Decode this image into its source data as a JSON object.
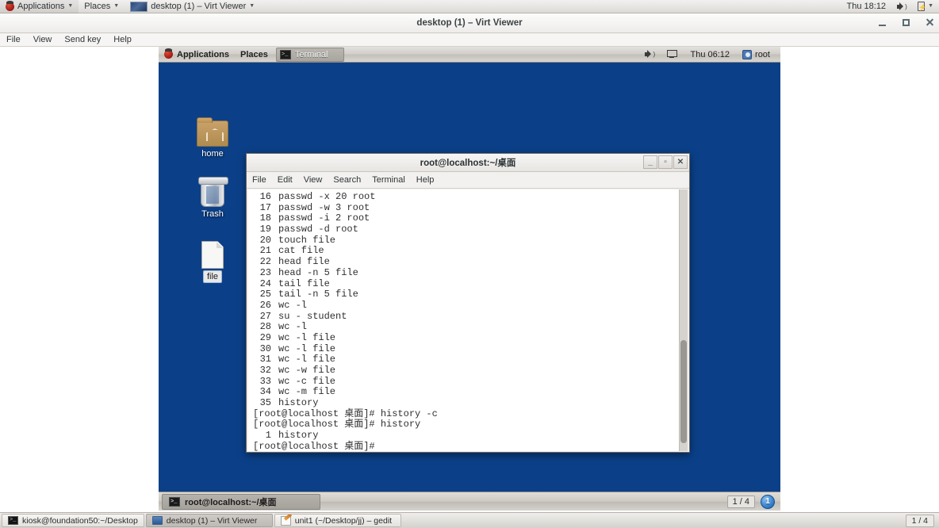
{
  "host_panel": {
    "applications_label": "Applications",
    "places_label": "Places",
    "window_menu_label": "desktop (1) – Virt Viewer",
    "clock": "Thu 18:12"
  },
  "virt_viewer": {
    "title": "desktop (1) – Virt Viewer",
    "menu": [
      "File",
      "View",
      "Send key",
      "Help"
    ],
    "controls": [
      "minimize",
      "maximize",
      "close"
    ]
  },
  "guest_panel": {
    "applications_label": "Applications",
    "places_label": "Places",
    "active_task": "Terminal",
    "clock": "Thu 06:12",
    "user": "root"
  },
  "desktop_icons": [
    {
      "name": "home",
      "label": "home",
      "icon": "home-folder-icon",
      "selected": false
    },
    {
      "name": "trash",
      "label": "Trash",
      "icon": "trash-icon",
      "selected": false
    },
    {
      "name": "file",
      "label": "file",
      "icon": "text-file-icon",
      "selected": true
    }
  ],
  "terminal": {
    "title": "root@localhost:~/桌面",
    "menu": [
      "File",
      "Edit",
      "View",
      "Search",
      "Terminal",
      "Help"
    ],
    "controls": {
      "minimize": "_",
      "maximize": "▫",
      "close": "✕"
    },
    "prompt": "[root@localhost 桌面]#",
    "history": [
      {
        "n": "16",
        "cmd": "passwd -x 20 root"
      },
      {
        "n": "17",
        "cmd": "passwd -w 3 root"
      },
      {
        "n": "18",
        "cmd": "passwd -i 2 root"
      },
      {
        "n": "19",
        "cmd": "passwd -d root"
      },
      {
        "n": "20",
        "cmd": "touch file"
      },
      {
        "n": "21",
        "cmd": "cat file"
      },
      {
        "n": "22",
        "cmd": "head file"
      },
      {
        "n": "23",
        "cmd": "head -n 5 file"
      },
      {
        "n": "24",
        "cmd": "tail file"
      },
      {
        "n": "25",
        "cmd": "tail -n 5 file"
      },
      {
        "n": "26",
        "cmd": "wc -l"
      },
      {
        "n": "27",
        "cmd": "su - student"
      },
      {
        "n": "28",
        "cmd": "wc -l"
      },
      {
        "n": "29",
        "cmd": "wc -l file"
      },
      {
        "n": "30",
        "cmd": "wc -l file"
      },
      {
        "n": "31",
        "cmd": "wc -l file"
      },
      {
        "n": "32",
        "cmd": "wc -w file"
      },
      {
        "n": "33",
        "cmd": "wc -c file"
      },
      {
        "n": "34",
        "cmd": "wc -m file"
      },
      {
        "n": "35",
        "cmd": "history"
      }
    ],
    "session_lines": [
      {
        "type": "prompt",
        "text": "[root@localhost 桌面]# history -c"
      },
      {
        "type": "prompt",
        "text": "[root@localhost 桌面]# history"
      },
      {
        "type": "history",
        "n": "1",
        "cmd": "history"
      },
      {
        "type": "prompt",
        "text": "[root@localhost 桌面]#"
      }
    ]
  },
  "guest_taskbar": {
    "task_label": "root@localhost:~/桌面",
    "workspace_count": "1 / 4",
    "workspace_badge": "1"
  },
  "host_taskbar": {
    "tasks": [
      {
        "label": "kiosk@foundation50:~/Desktop",
        "icon": "terminal-icon",
        "active": false
      },
      {
        "label": "desktop (1) – Virt Viewer",
        "icon": "monitor-icon",
        "active": true
      },
      {
        "label": "unit1 (~/Desktop/jj) – gedit",
        "icon": "gedit-icon",
        "active": false
      }
    ],
    "workspace_count": "1 / 4"
  },
  "colors": {
    "desktop_blue": "#0b4089",
    "panel_grey": "#d2cfca",
    "terminal_bg": "#ffffff",
    "terminal_fg": "#2f2f2f",
    "accent_blue": "#3d86d0"
  }
}
